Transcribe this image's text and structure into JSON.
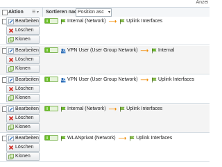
{
  "top_right_text": "Anzei",
  "header": {
    "action_label": "Aktion",
    "menu_icon": "list-menu-icon",
    "sort_label": "Sortieren nach:",
    "sort_value": "Position asc",
    "sort_arrow": "▾"
  },
  "buttons": {
    "edit": "Bearbeiten",
    "delete": "Löschen",
    "clone": "Klonen"
  },
  "rules": [
    {
      "source": "Internal (Network)",
      "source_icon": "network-flag-icon",
      "destination": "Uplink Interfaces",
      "dest_icon": "interface-flag-icon"
    },
    {
      "source": "VPN User (User Group Network)",
      "source_icon": "user-group-icon",
      "destination": "Internal",
      "dest_icon": "network-flag-icon"
    },
    {
      "source": "VPN User (User Group Network)",
      "source_icon": "user-group-icon",
      "destination": "Uplink Interfaces",
      "dest_icon": "interface-flag-icon"
    },
    {
      "source": "Internal (Network)",
      "source_icon": "network-flag-icon",
      "destination": "Uplink Interfaces",
      "dest_icon": "interface-flag-icon"
    },
    {
      "source": "WLANprivat (Network)",
      "source_icon": "network-flag-icon",
      "destination": "Uplink Interfaces",
      "dest_icon": "interface-flag-icon"
    }
  ],
  "colors": {
    "toggle_green": "#6cbf2a",
    "arrow_orange": "#f08a00",
    "delete_red": "#d0281e",
    "edit_blue": "#3b78c4"
  }
}
